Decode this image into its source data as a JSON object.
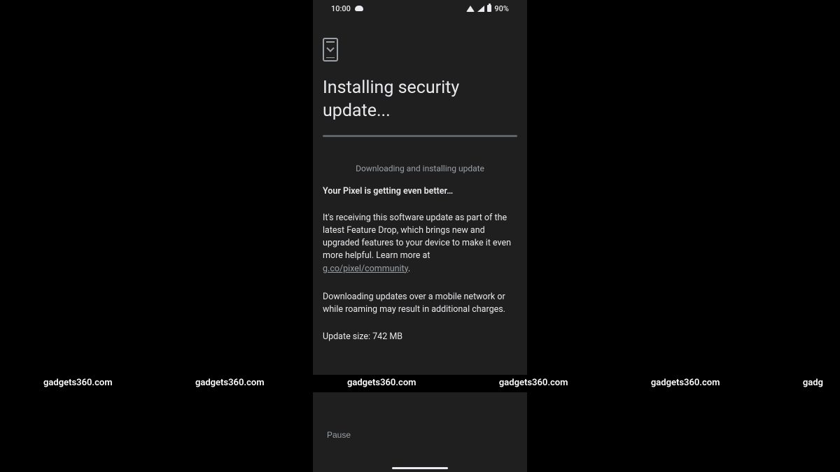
{
  "status_bar": {
    "time": "10:00",
    "battery": "90%"
  },
  "page": {
    "title": "Installing security update...",
    "status": "Downloading and installing update",
    "subtitle": "Your Pixel is getting even better…",
    "description_part1": "It's receiving this software update as part of the latest Feature Drop, which brings new and upgraded features to your device to make it even more helpful. Learn more at ",
    "link_text": "g.co/pixel/community",
    "description_part2": ".",
    "warning": "Downloading updates over a mobile network or while roaming may result in additional charges.",
    "size": "Update size: 742 MB"
  },
  "actions": {
    "pause": "Pause"
  },
  "watermark": "gadgets360.com",
  "watermark_partial": "gadg"
}
